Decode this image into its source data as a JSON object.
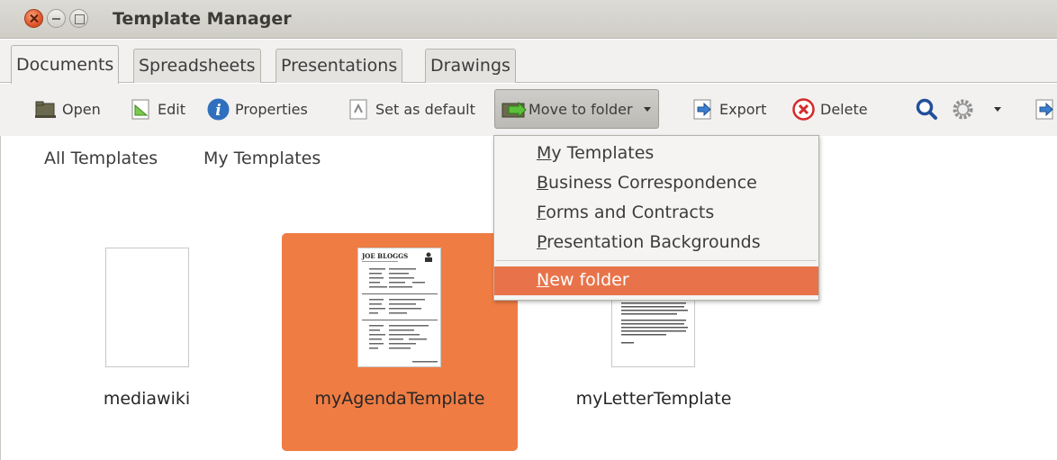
{
  "window": {
    "title": "Template Manager"
  },
  "tabs": [
    {
      "label": "Documents",
      "active": true
    },
    {
      "label": "Spreadsheets",
      "active": false
    },
    {
      "label": "Presentations",
      "active": false
    },
    {
      "label": "Drawings",
      "active": false
    }
  ],
  "toolbar": {
    "open": "Open",
    "edit": "Edit",
    "properties": "Properties",
    "set_default": "Set as default",
    "move_to_folder": "Move to folder",
    "export": "Export",
    "delete": "Delete"
  },
  "filter": {
    "all": "All Templates",
    "my": "My Templates"
  },
  "menu": {
    "items": [
      {
        "mnemonic": "M",
        "rest": "y Templates"
      },
      {
        "mnemonic": "B",
        "rest": "usiness Correspondence"
      },
      {
        "mnemonic": "F",
        "rest": "orms and Contracts"
      },
      {
        "mnemonic": "P",
        "rest": "resentation Backgrounds"
      }
    ],
    "new_folder": {
      "mnemonic": "N",
      "rest": "ew folder"
    }
  },
  "thumbnails": [
    {
      "name": "mediawiki",
      "selected": false
    },
    {
      "name": "myAgendaTemplate",
      "selected": true
    },
    {
      "name": "myLetterTemplate",
      "selected": false
    }
  ],
  "agenda_preview": {
    "heading": "JOE BLOGGS"
  },
  "colors": {
    "selection": "#ef7c43",
    "menu_highlight": "#e8734a",
    "close_button": "#e0562b"
  }
}
